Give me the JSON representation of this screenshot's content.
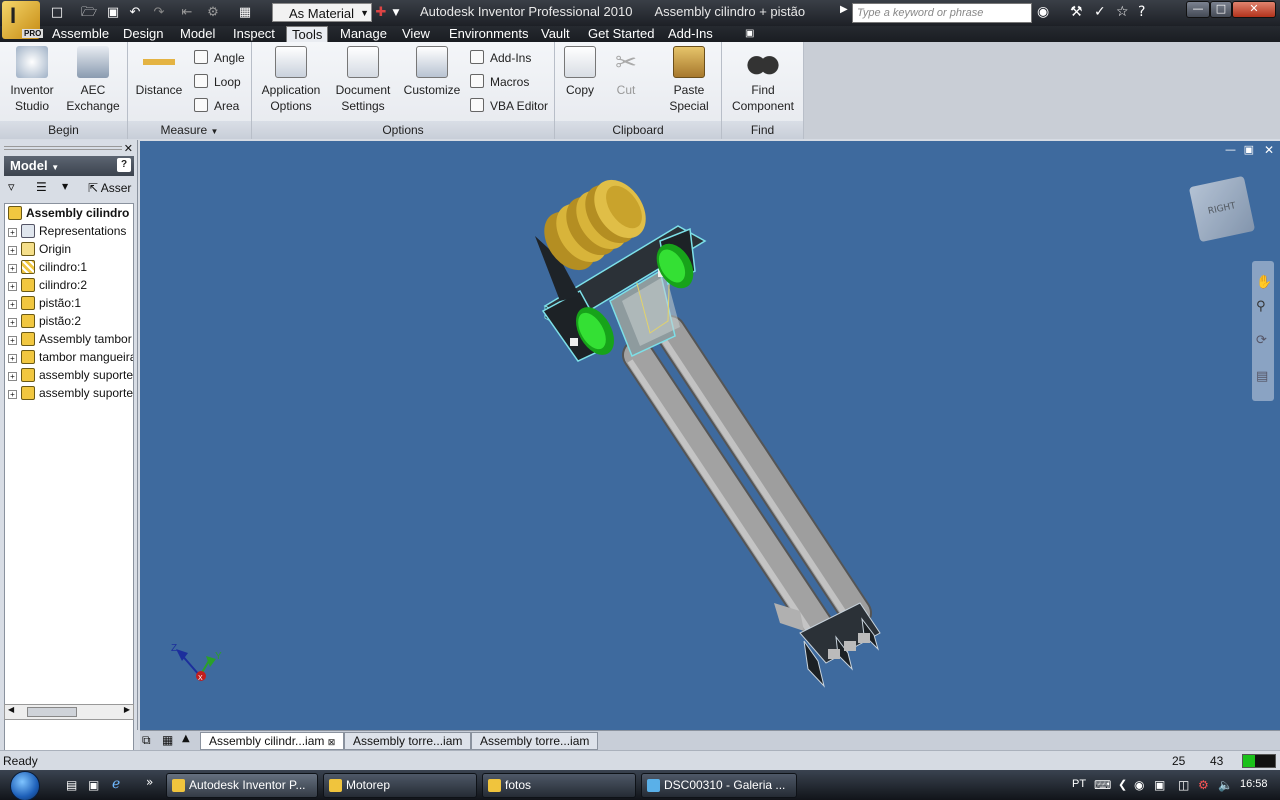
{
  "window": {
    "app_title": "Autodesk Inventor Professional 2010",
    "doc_title": "Assembly cilindro + pistão",
    "material_value": "As Material",
    "search_placeholder": "Type a keyword or phrase"
  },
  "menu_tabs": [
    "Assemble",
    "Design",
    "Model",
    "Inspect",
    "Tools",
    "Manage",
    "View",
    "Environments",
    "Vault",
    "Get Started",
    "Add-Ins"
  ],
  "active_tab": "Tools",
  "ribbon": {
    "begin": {
      "title": "Begin",
      "inventor_studio": "Inventor\nStudio",
      "aec_exchange": "AEC\nExchange"
    },
    "measure": {
      "title": "Measure",
      "distance": "Distance",
      "angle": "Angle",
      "loop": "Loop",
      "area": "Area"
    },
    "options": {
      "title": "Options",
      "application_options": "Application\nOptions",
      "document_settings": "Document\nSettings",
      "customize": "Customize",
      "add_ins": "Add-Ins",
      "macros": "Macros",
      "vba_editor": "VBA Editor"
    },
    "clipboard": {
      "title": "Clipboard",
      "copy": "Copy",
      "cut": "Cut",
      "paste_special": "Paste\nSpecial"
    },
    "find": {
      "title": "Find",
      "find_component": "Find\nComponent"
    }
  },
  "browser": {
    "title": "Model",
    "toolbar_label": "Asser",
    "root": "Assembly cilindro",
    "items": [
      "Representations",
      "Origin",
      "cilindro:1",
      "cilindro:2",
      "pistão:1",
      "pistão:2",
      "Assembly tambor",
      "tambor mangueira",
      "assembly suporte",
      "assembly suporte"
    ]
  },
  "doc_tabs": [
    "Assembly cilindr...iam",
    "Assembly torre...iam",
    "Assembly torre...iam"
  ],
  "status": {
    "text": "Ready",
    "num1": "25",
    "num2": "43"
  },
  "viewcube": {
    "face_label": "RIGHT"
  },
  "triad": {
    "x": "X",
    "y": "Y",
    "z": "Z"
  },
  "taskbar": {
    "tasks": [
      "Autodesk Inventor P...",
      "Motorep",
      "fotos",
      "DSC00310 - Galeria ..."
    ],
    "lang": "PT",
    "clock": "16:58"
  },
  "colors": {
    "viewport_bg": "#3e6a9e",
    "coil_gold": "#d8b43a",
    "wheel_green": "#2ccf2c",
    "rod_gray": "#9a9a9a"
  }
}
